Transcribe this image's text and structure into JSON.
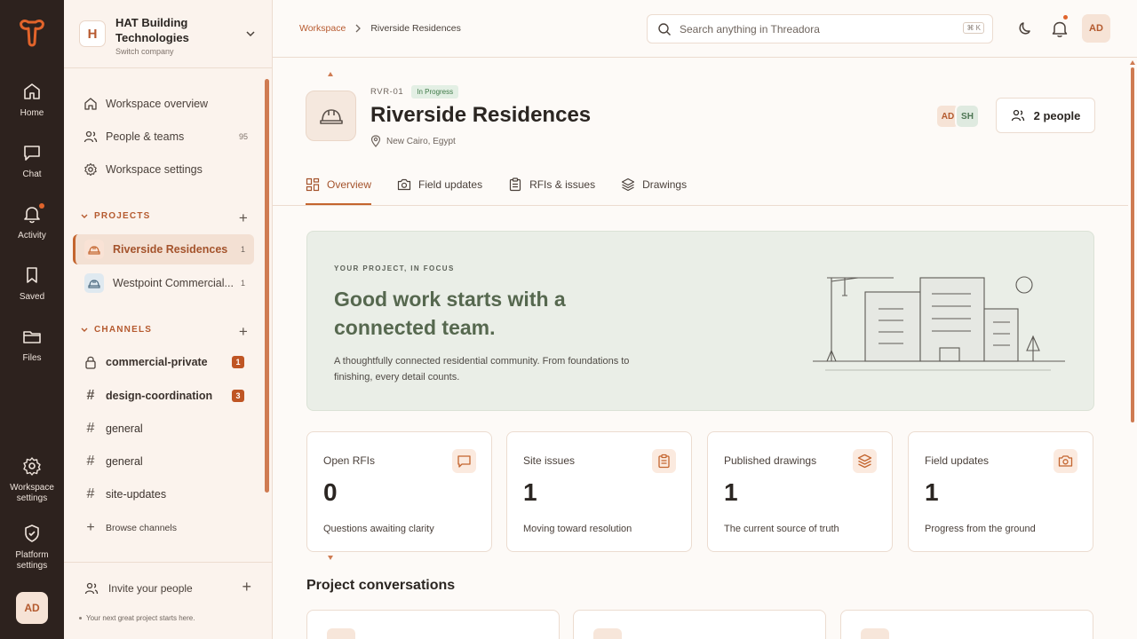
{
  "rail": {
    "items": [
      {
        "label": "Home",
        "icon": "home-icon"
      },
      {
        "label": "Chat",
        "icon": "chat-icon"
      },
      {
        "label": "Activity",
        "icon": "bell-icon"
      },
      {
        "label": "Saved",
        "icon": "bookmark-icon"
      },
      {
        "label": "Files",
        "icon": "folder-icon"
      },
      {
        "label": "Workspace settings",
        "icon": "gear-icon"
      },
      {
        "label": "Platform settings",
        "icon": "shield-icon"
      }
    ],
    "avatar": "AD"
  },
  "company": {
    "initial": "H",
    "name": "HAT Building Technologies",
    "switch_label": "Switch company"
  },
  "nav": [
    {
      "label": "Workspace overview",
      "icon": "home-icon"
    },
    {
      "label": "People & teams",
      "icon": "people-icon",
      "count": "95"
    },
    {
      "label": "Workspace settings",
      "icon": "gear-icon"
    }
  ],
  "projects": {
    "heading": "PROJECTS",
    "items": [
      {
        "label": "Riverside Residences",
        "count": "1",
        "active": true
      },
      {
        "label": "Westpoint Commercial...",
        "count": "1",
        "active": false
      }
    ]
  },
  "channels": {
    "heading": "CHANNELS",
    "items": [
      {
        "label": "commercial-private",
        "private": true,
        "badge": "1",
        "bold": true
      },
      {
        "label": "design-coordination",
        "private": false,
        "badge": "3",
        "bold": true
      },
      {
        "label": "general",
        "private": false
      },
      {
        "label": "general",
        "private": false
      },
      {
        "label": "site-updates",
        "private": false
      }
    ],
    "browse_label": "Browse channels"
  },
  "invite": {
    "label": "Invite your people",
    "note": "Your next great project starts here."
  },
  "breadcrumb": {
    "root": "Workspace",
    "current": "Riverside Residences"
  },
  "search": {
    "placeholder": "Search anything in Threadora",
    "shortcut": "⌘ K"
  },
  "user_avatar": "AD",
  "project": {
    "code": "RVR-01",
    "status": "In Progress",
    "title": "Riverside Residences",
    "location": "New Cairo, Egypt",
    "members": [
      "AD",
      "SH"
    ],
    "people_label": "2 people"
  },
  "tabs": [
    {
      "label": "Overview",
      "icon": "grid-icon",
      "active": true
    },
    {
      "label": "Field updates",
      "icon": "camera-icon",
      "active": false
    },
    {
      "label": "RFIs & issues",
      "icon": "clipboard-icon",
      "active": false
    },
    {
      "label": "Drawings",
      "icon": "layers-icon",
      "active": false
    }
  ],
  "hero": {
    "kicker": "YOUR PROJECT, IN FOCUS",
    "title": "Good work starts with a connected team.",
    "description": "A thoughtfully connected residential community. From foundations to finishing, every detail counts."
  },
  "stats": [
    {
      "label": "Open RFIs",
      "value": "0",
      "sub": "Questions awaiting clarity",
      "icon": "chat-icon"
    },
    {
      "label": "Site issues",
      "value": "1",
      "sub": "Moving toward resolution",
      "icon": "clipboard-icon"
    },
    {
      "label": "Published drawings",
      "value": "1",
      "sub": "The current source of truth",
      "icon": "layers-icon"
    },
    {
      "label": "Field updates",
      "value": "1",
      "sub": "Progress from the ground",
      "icon": "camera-icon"
    }
  ],
  "conversations_title": "Project conversations",
  "colors": {
    "accent": "#c4652f",
    "rail": "#2d221e",
    "sidebar": "#fbf3ed",
    "hero": "#eaeee7"
  }
}
